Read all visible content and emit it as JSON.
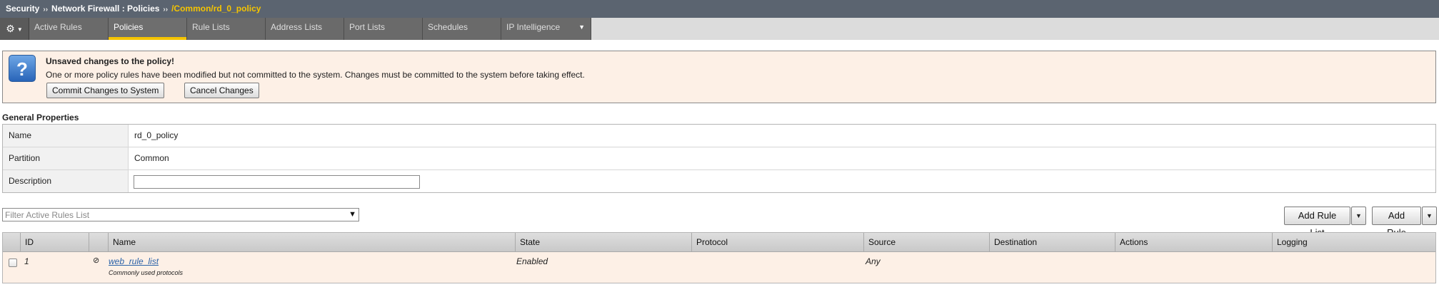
{
  "breadcrumb": {
    "section": "Security",
    "sep": "››",
    "page": "Network Firewall : Policies",
    "current": "/Common/rd_0_policy"
  },
  "tabs": [
    {
      "label": "Active Rules"
    },
    {
      "label": "Policies",
      "active": true
    },
    {
      "label": "Rule Lists"
    },
    {
      "label": "Address Lists"
    },
    {
      "label": "Port Lists"
    },
    {
      "label": "Schedules"
    },
    {
      "label": "IP Intelligence"
    }
  ],
  "alert": {
    "title": "Unsaved changes to the policy!",
    "message": "One or more policy rules have been modified but not committed to the system. Changes must be committed to the system before taking effect.",
    "commit_label": "Commit Changes to System",
    "cancel_label": "Cancel Changes",
    "icon": "question-icon"
  },
  "general": {
    "title": "General Properties",
    "name_label": "Name",
    "name_value": "rd_0_policy",
    "partition_label": "Partition",
    "partition_value": "Common",
    "description_label": "Description",
    "description_value": ""
  },
  "rules_toolbar": {
    "filter_placeholder": "Filter Active Rules List",
    "add_rule_list_label": "Add Rule List",
    "add_rule_label": "Add Rule"
  },
  "rules_table": {
    "columns": [
      "ID",
      "Name",
      "State",
      "Protocol",
      "Source",
      "Destination",
      "Actions",
      "Logging"
    ],
    "rows": [
      {
        "id": "1",
        "name": "web_rule_list",
        "description": "Commonly used protocols",
        "state": "Enabled",
        "protocol": "",
        "source": "Any",
        "destination": "",
        "actions": "",
        "logging": ""
      }
    ]
  },
  "colors": {
    "topbar": "#5b6470",
    "accent": "#f5c400",
    "alert_bg": "#fdf0e6",
    "link": "#2a62a8"
  }
}
